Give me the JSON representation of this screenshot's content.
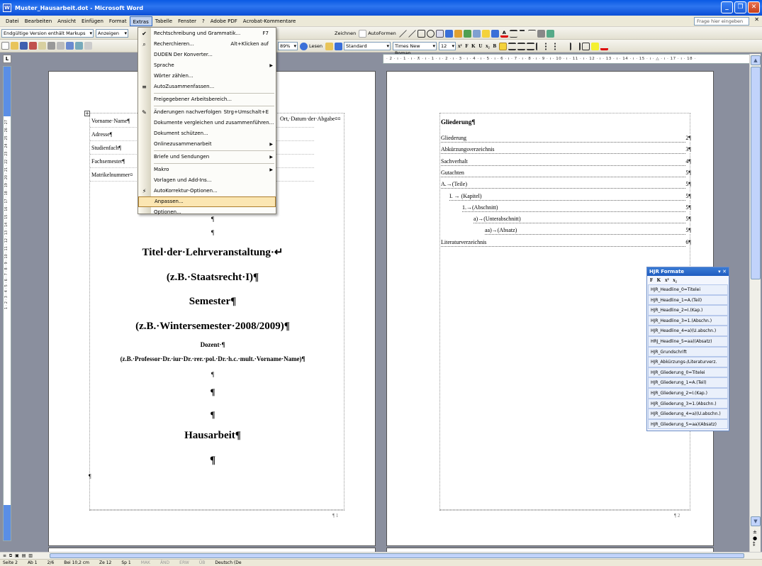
{
  "window": {
    "title": "Muster_Hausarbeit.dot - Microsoft Word",
    "app_icon": "W"
  },
  "menubar": {
    "items": [
      "Datei",
      "Bearbeiten",
      "Ansicht",
      "Einfügen",
      "Format",
      "Extras",
      "Tabelle",
      "Fenster",
      "?",
      "Adobe PDF",
      "Acrobat-Kommentare"
    ],
    "help_placeholder": "Frage hier eingeben"
  },
  "toolbar1": {
    "markup_view": "Endgültige Version enthält Markups",
    "show_label": "Anzeigen",
    "zeichnen": "Zeichnen",
    "autoformen": "AutoFormen"
  },
  "toolbar2": {
    "zoom": "89%",
    "lesen": "Lesen",
    "style": "Standard",
    "font": "Times New Roman",
    "size": "12"
  },
  "ruler_h": "· 2 · ı · 1 · ı · ⊼ · ı · 1 · ı · 2 · ı · 3 · ı · 4 · ı · 5 · ı · 6 · ı · 7 · ı · 8 · ı · 9 · ı · 10 · ı · 11 · ı · 12 · ı · 13 · ı · 14 · ı · 15 · ı · △ · ı · 17 · ı · 18 ·",
  "ruler_v": "1 · 2 · 3 · 4 · 5 · 6 · 7 · 8 · 9 · 10 · 11 · 12 · 13 · 14 · 15 · 16 · 17 · 18 · 19 · 20 · 21 · 22 · 23 · 24 · 25 · 26 · 27",
  "extras_menu": {
    "items": [
      {
        "label": "Rechtschreibung und Grammatik...",
        "shortcut": "F7",
        "icon": "spellcheck-icon",
        "glyph": "✔"
      },
      {
        "label": "Recherchieren...",
        "shortcut": "Alt+Klicken auf",
        "icon": "research-icon",
        "glyph": "⌕"
      },
      {
        "label": "DUDEN Der Konverter...",
        "shortcut": "",
        "icon": "",
        "glyph": ""
      },
      {
        "label": "Sprache",
        "shortcut": "",
        "icon": "",
        "glyph": "",
        "submenu": true
      },
      {
        "label": "Wörter zählen...",
        "shortcut": "",
        "icon": "",
        "glyph": ""
      },
      {
        "label": "AutoZusammenfassen...",
        "shortcut": "",
        "icon": "autosummarize-icon",
        "glyph": "≡"
      },
      {
        "label": "Freigegebener Arbeitsbereich...",
        "shortcut": "",
        "icon": "",
        "glyph": "",
        "sep_before": true
      },
      {
        "label": "Änderungen nachverfolgen",
        "shortcut": "Strg+Umschalt+E",
        "icon": "track-changes-icon",
        "glyph": "✎",
        "sep_before": true
      },
      {
        "label": "Dokumente vergleichen und zusammenführen...",
        "shortcut": "",
        "icon": "",
        "glyph": ""
      },
      {
        "label": "Dokument schützen...",
        "shortcut": "",
        "icon": "",
        "glyph": ""
      },
      {
        "label": "Onlinezusammenarbeit",
        "shortcut": "",
        "icon": "",
        "glyph": "",
        "submenu": true
      },
      {
        "label": "Briefe und Sendungen",
        "shortcut": "",
        "icon": "",
        "glyph": "",
        "submenu": true,
        "sep_before": true
      },
      {
        "label": "Makro",
        "shortcut": "",
        "icon": "",
        "glyph": "",
        "submenu": true,
        "sep_before": true
      },
      {
        "label": "Vorlagen und Add-Ins...",
        "shortcut": "",
        "icon": "",
        "glyph": ""
      },
      {
        "label": "AutoKorrektur-Optionen...",
        "shortcut": "",
        "icon": "autocorrect-icon",
        "glyph": "⚡"
      },
      {
        "label": "Anpassen...",
        "shortcut": "",
        "icon": "",
        "glyph": "",
        "highlighted": true
      },
      {
        "label": "Optionen...",
        "shortcut": "",
        "icon": "",
        "glyph": ""
      }
    ]
  },
  "page1": {
    "info_rows": [
      "Vorname·Name¶",
      "Adresse¶",
      "Studienfach¶",
      "Fachsemester¶",
      "Matrikelnummer¤"
    ],
    "ort_datum": "Ort,·Datum·der·Abgabe¤¤",
    "lines": [
      {
        "text": "¶",
        "size": 9,
        "bold": false
      },
      {
        "text": "¶",
        "size": 9,
        "bold": false
      },
      {
        "text": "Titel·der·Lehrveranstaltung·↵",
        "size": 15
      },
      {
        "text": "(z.B.·Staatsrecht·I)¶",
        "size": 15
      },
      {
        "text": "Semester¶",
        "size": 15
      },
      {
        "text": "(z.B.·Wintersemester·2008/2009)¶",
        "size": 15
      },
      {
        "text": "Dozent·¶",
        "size": 9
      },
      {
        "text": "(z.B.·Professor·Dr.·iur·Dr.·rer.·pol.·Dr.·h.c.·mult.·Vorname·Name)¶",
        "size": 9
      },
      {
        "text": "¶",
        "size": 9
      },
      {
        "text": "¶",
        "size": 13
      },
      {
        "text": "¶",
        "size": 13
      },
      {
        "text": "Hausarbeit¶",
        "size": 15
      },
      {
        "text": "¶",
        "size": 15
      }
    ],
    "trailing_pilcrow": "¶",
    "page_no": "¶ 1"
  },
  "page2": {
    "heading": "Gliederung¶",
    "toc": [
      {
        "label": "Gliederung",
        "page": "2¶",
        "indent": 0
      },
      {
        "label": "Abkürzungsverzeichnis",
        "page": "3¶",
        "indent": 0
      },
      {
        "label": "Sachverhalt",
        "page": "4¶",
        "indent": 0
      },
      {
        "label": "Gutachten",
        "page": "5¶",
        "indent": 0
      },
      {
        "label": "A.→(Teile)",
        "page": "5¶",
        "indent": 0
      },
      {
        "label": "I. → (Kapitel)",
        "page": "5¶",
        "indent": 12
      },
      {
        "label": "1.→(Abschnitt)",
        "page": "5¶",
        "indent": 30
      },
      {
        "label": "a)→(Unterabschnitt)",
        "page": "5¶",
        "indent": 46
      },
      {
        "label": "aa)→(Absatz)",
        "page": "5¶",
        "indent": 62
      },
      {
        "label": "Literaturverzeichnis",
        "page": "6¶",
        "indent": 0
      }
    ],
    "page_no": "¶ 2"
  },
  "taskpane": {
    "title": "HJR Formate",
    "tools": "F K x² x₂",
    "items": [
      "HJR_Headline_0=Titelei",
      "HJR_Headline_1=A.(Teil)",
      "HJR_Headline_2=I.(Kap.)",
      "HJR_Headline_3=1.(Abschn.)",
      "HJR_Headline_4=a)(U.abschn.)",
      "HRJ_Headline_5=aa)(Absatz)",
      "HJR_Grundschrift",
      "HJR_Abkürzungs-/Literaturverz.",
      "HJR_Gliederung_0=Titelei",
      "HJR_Gliederung_1=A.(Teil)",
      "HJR_Gliederung_2=I.(Kap.)",
      "HJR_Gliederung_3=1.(Abschn.)",
      "HJR_Gliederung_4=a)(U.abschn.)",
      "HJR_Gliederung_5=aa)(Absatz)"
    ]
  },
  "statusbar": {
    "seite": "Seite 2",
    "ab": "Ab 1",
    "pages": "2/6",
    "pos": "Bei 10,2 cm",
    "ze": "Ze 12",
    "sp": "Sp 1",
    "mak": "MAK",
    "and": "ÄND",
    "erw": "ERW",
    "ub": "ÜB",
    "lang": "Deutsch (De"
  },
  "colors": {
    "titlebar": "#0a5ae4",
    "menu_highlight": "#fbe6b2",
    "taskpane_title": "#1f5cc0"
  }
}
